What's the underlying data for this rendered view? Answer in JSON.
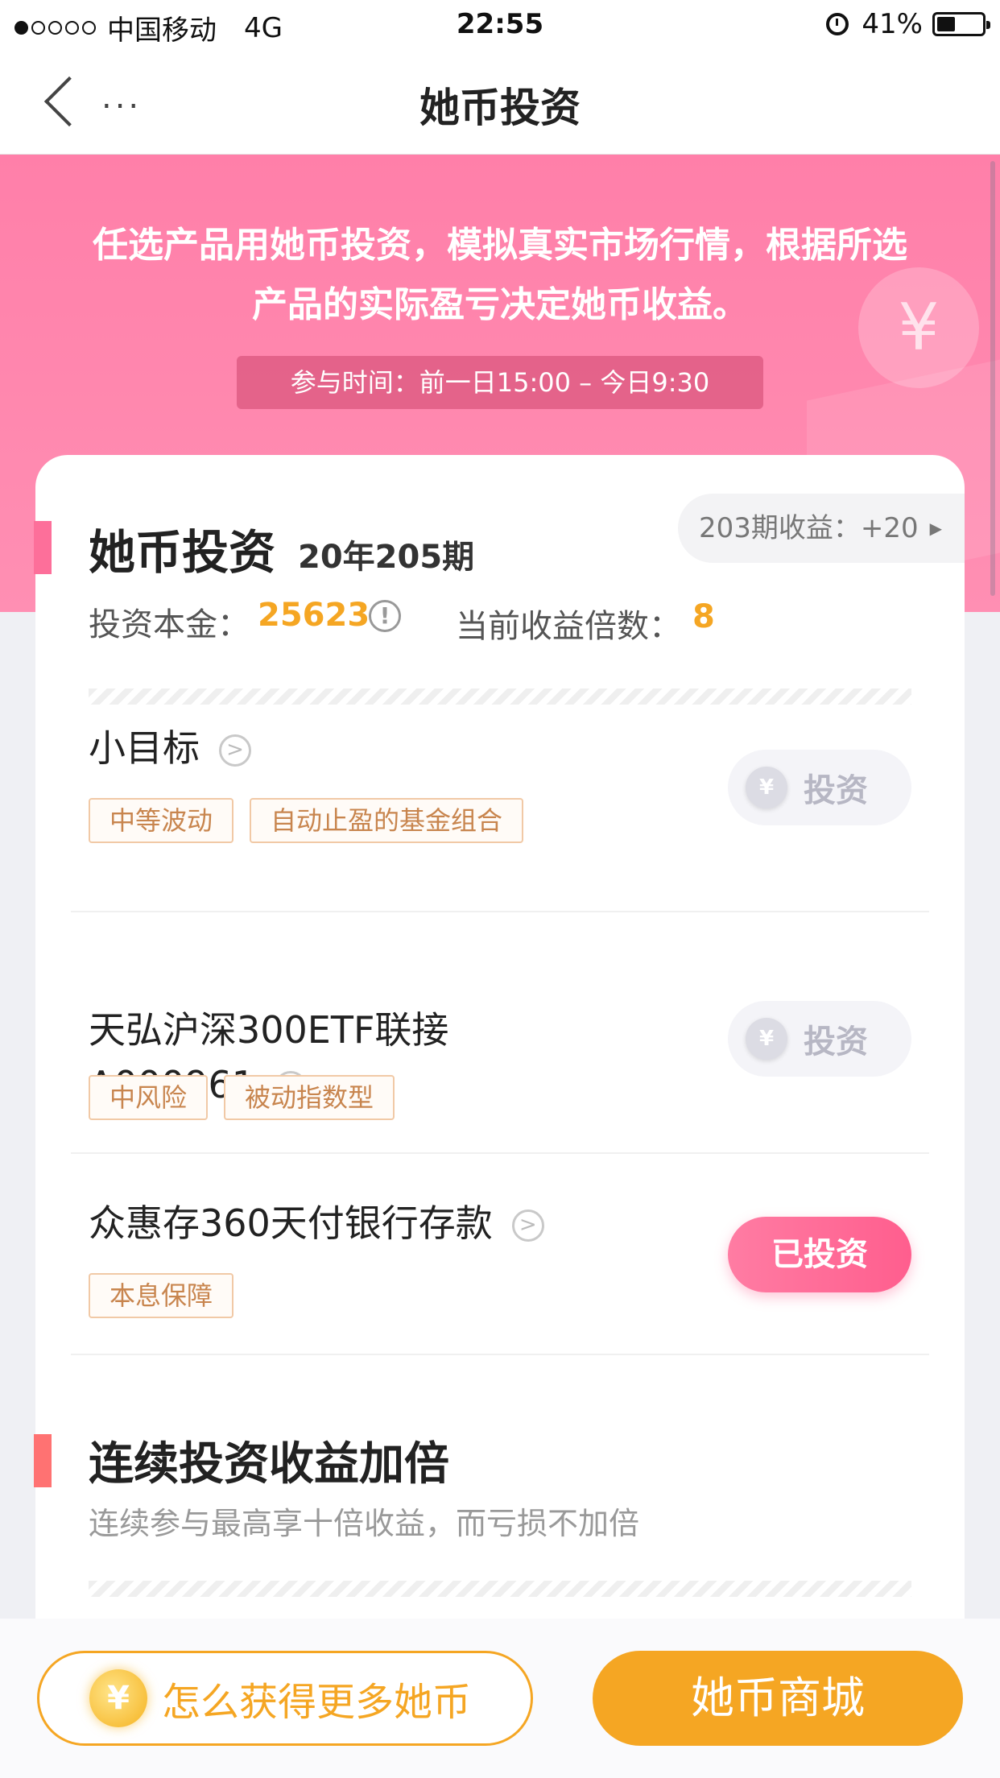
{
  "status_bar": {
    "carrier": "中国移动",
    "network": "4G",
    "time": "22:55",
    "battery": "41%",
    "battery_level": 0.41
  },
  "nav": {
    "more": "...",
    "title": "她币投资"
  },
  "hero": {
    "description": "任选产品用她币投资，模拟真实市场行情，根据所选产品的实际盈亏决定她币收益。",
    "participation_time": "参与时间：前一日15:00 – 今日9:30",
    "coin_symbol": "¥"
  },
  "investment": {
    "title": "她币投资",
    "period": "20年205期",
    "previous_income": "203期收益：+20",
    "principal_label": "投资本金：",
    "principal_value": "25623",
    "info_symbol": "!",
    "multiple_label": "当前收益倍数：",
    "multiple_value": "8"
  },
  "products": [
    {
      "name": "小目标",
      "tags": [
        "中等波动",
        "自动止盈的基金组合"
      ],
      "action": "投资",
      "invested": false
    },
    {
      "name": "天弘沪深300ETF联接\nA000961",
      "tags": [
        "中风险",
        "被动指数型"
      ],
      "action": "投资",
      "invested": false
    },
    {
      "name": "众惠存360天付银行存款",
      "tags": [
        "本息保障"
      ],
      "action": "已投资",
      "invested": true
    }
  ],
  "bonus": {
    "title": "连续投资收益加倍",
    "subtitle": "连续参与最高享十倍收益，而亏损不加倍"
  },
  "bottom": {
    "earn_label": "怎么获得更多她币",
    "shop_label": "她币商城",
    "coin_symbol": "¥"
  },
  "colors": {
    "brand_pink": "#ff7fa9",
    "accent_orange": "#f5a623",
    "invested_pink": "#ff5e8e"
  }
}
